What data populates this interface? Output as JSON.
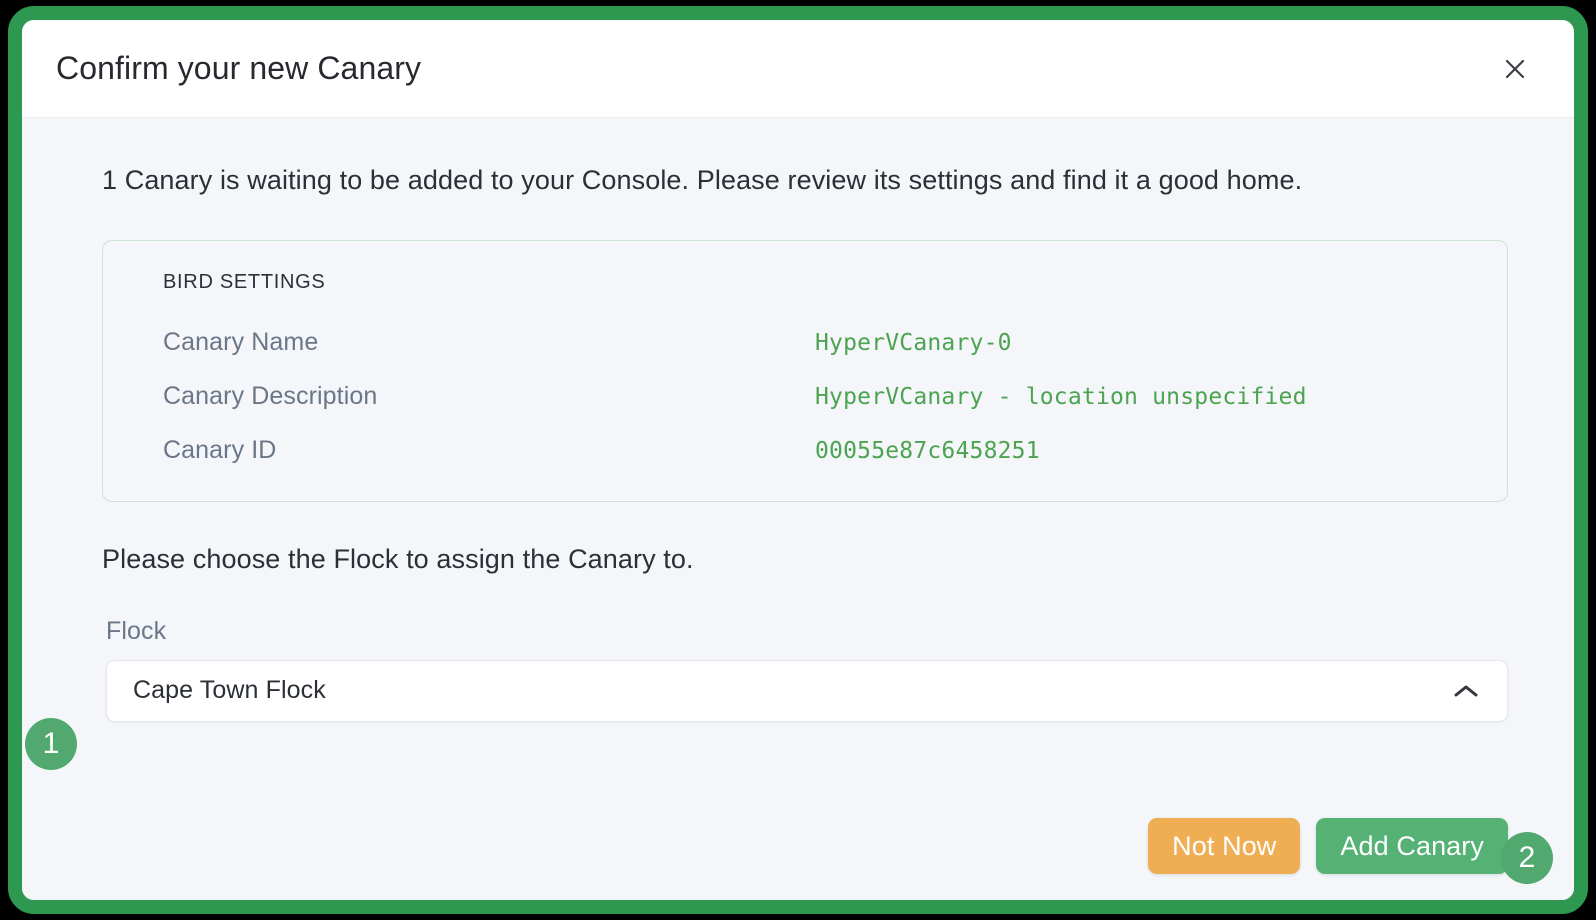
{
  "modal": {
    "title": "Confirm your new Canary",
    "close_icon": "close-icon",
    "intro": "1 Canary is waiting to be added to your Console. Please review its settings and find it a good home.",
    "choose_prompt": "Please choose the Flock to assign the Canary to."
  },
  "settings_card": {
    "heading": "BIRD SETTINGS",
    "rows": [
      {
        "label": "Canary Name",
        "value": "HyperVCanary-0"
      },
      {
        "label": "Canary Description",
        "value": "HyperVCanary - location unspecified"
      },
      {
        "label": "Canary ID",
        "value": "00055e87c6458251"
      }
    ]
  },
  "flock_field": {
    "label": "Flock",
    "selected": "Cape Town Flock",
    "chevron_icon": "chevron-up-icon"
  },
  "footer": {
    "not_now_label": "Not Now",
    "add_canary_label": "Add Canary"
  },
  "step_badges": [
    {
      "number": "1"
    },
    {
      "number": "2"
    }
  ],
  "colors": {
    "frame_green": "#2E9750",
    "primary_green": "#55B274",
    "badge_green": "#52A96F",
    "secondary_orange": "#EFAE54",
    "mono_green": "#4CA350",
    "label_gray": "#6B7687",
    "body_bg": "#F4F6FA"
  }
}
